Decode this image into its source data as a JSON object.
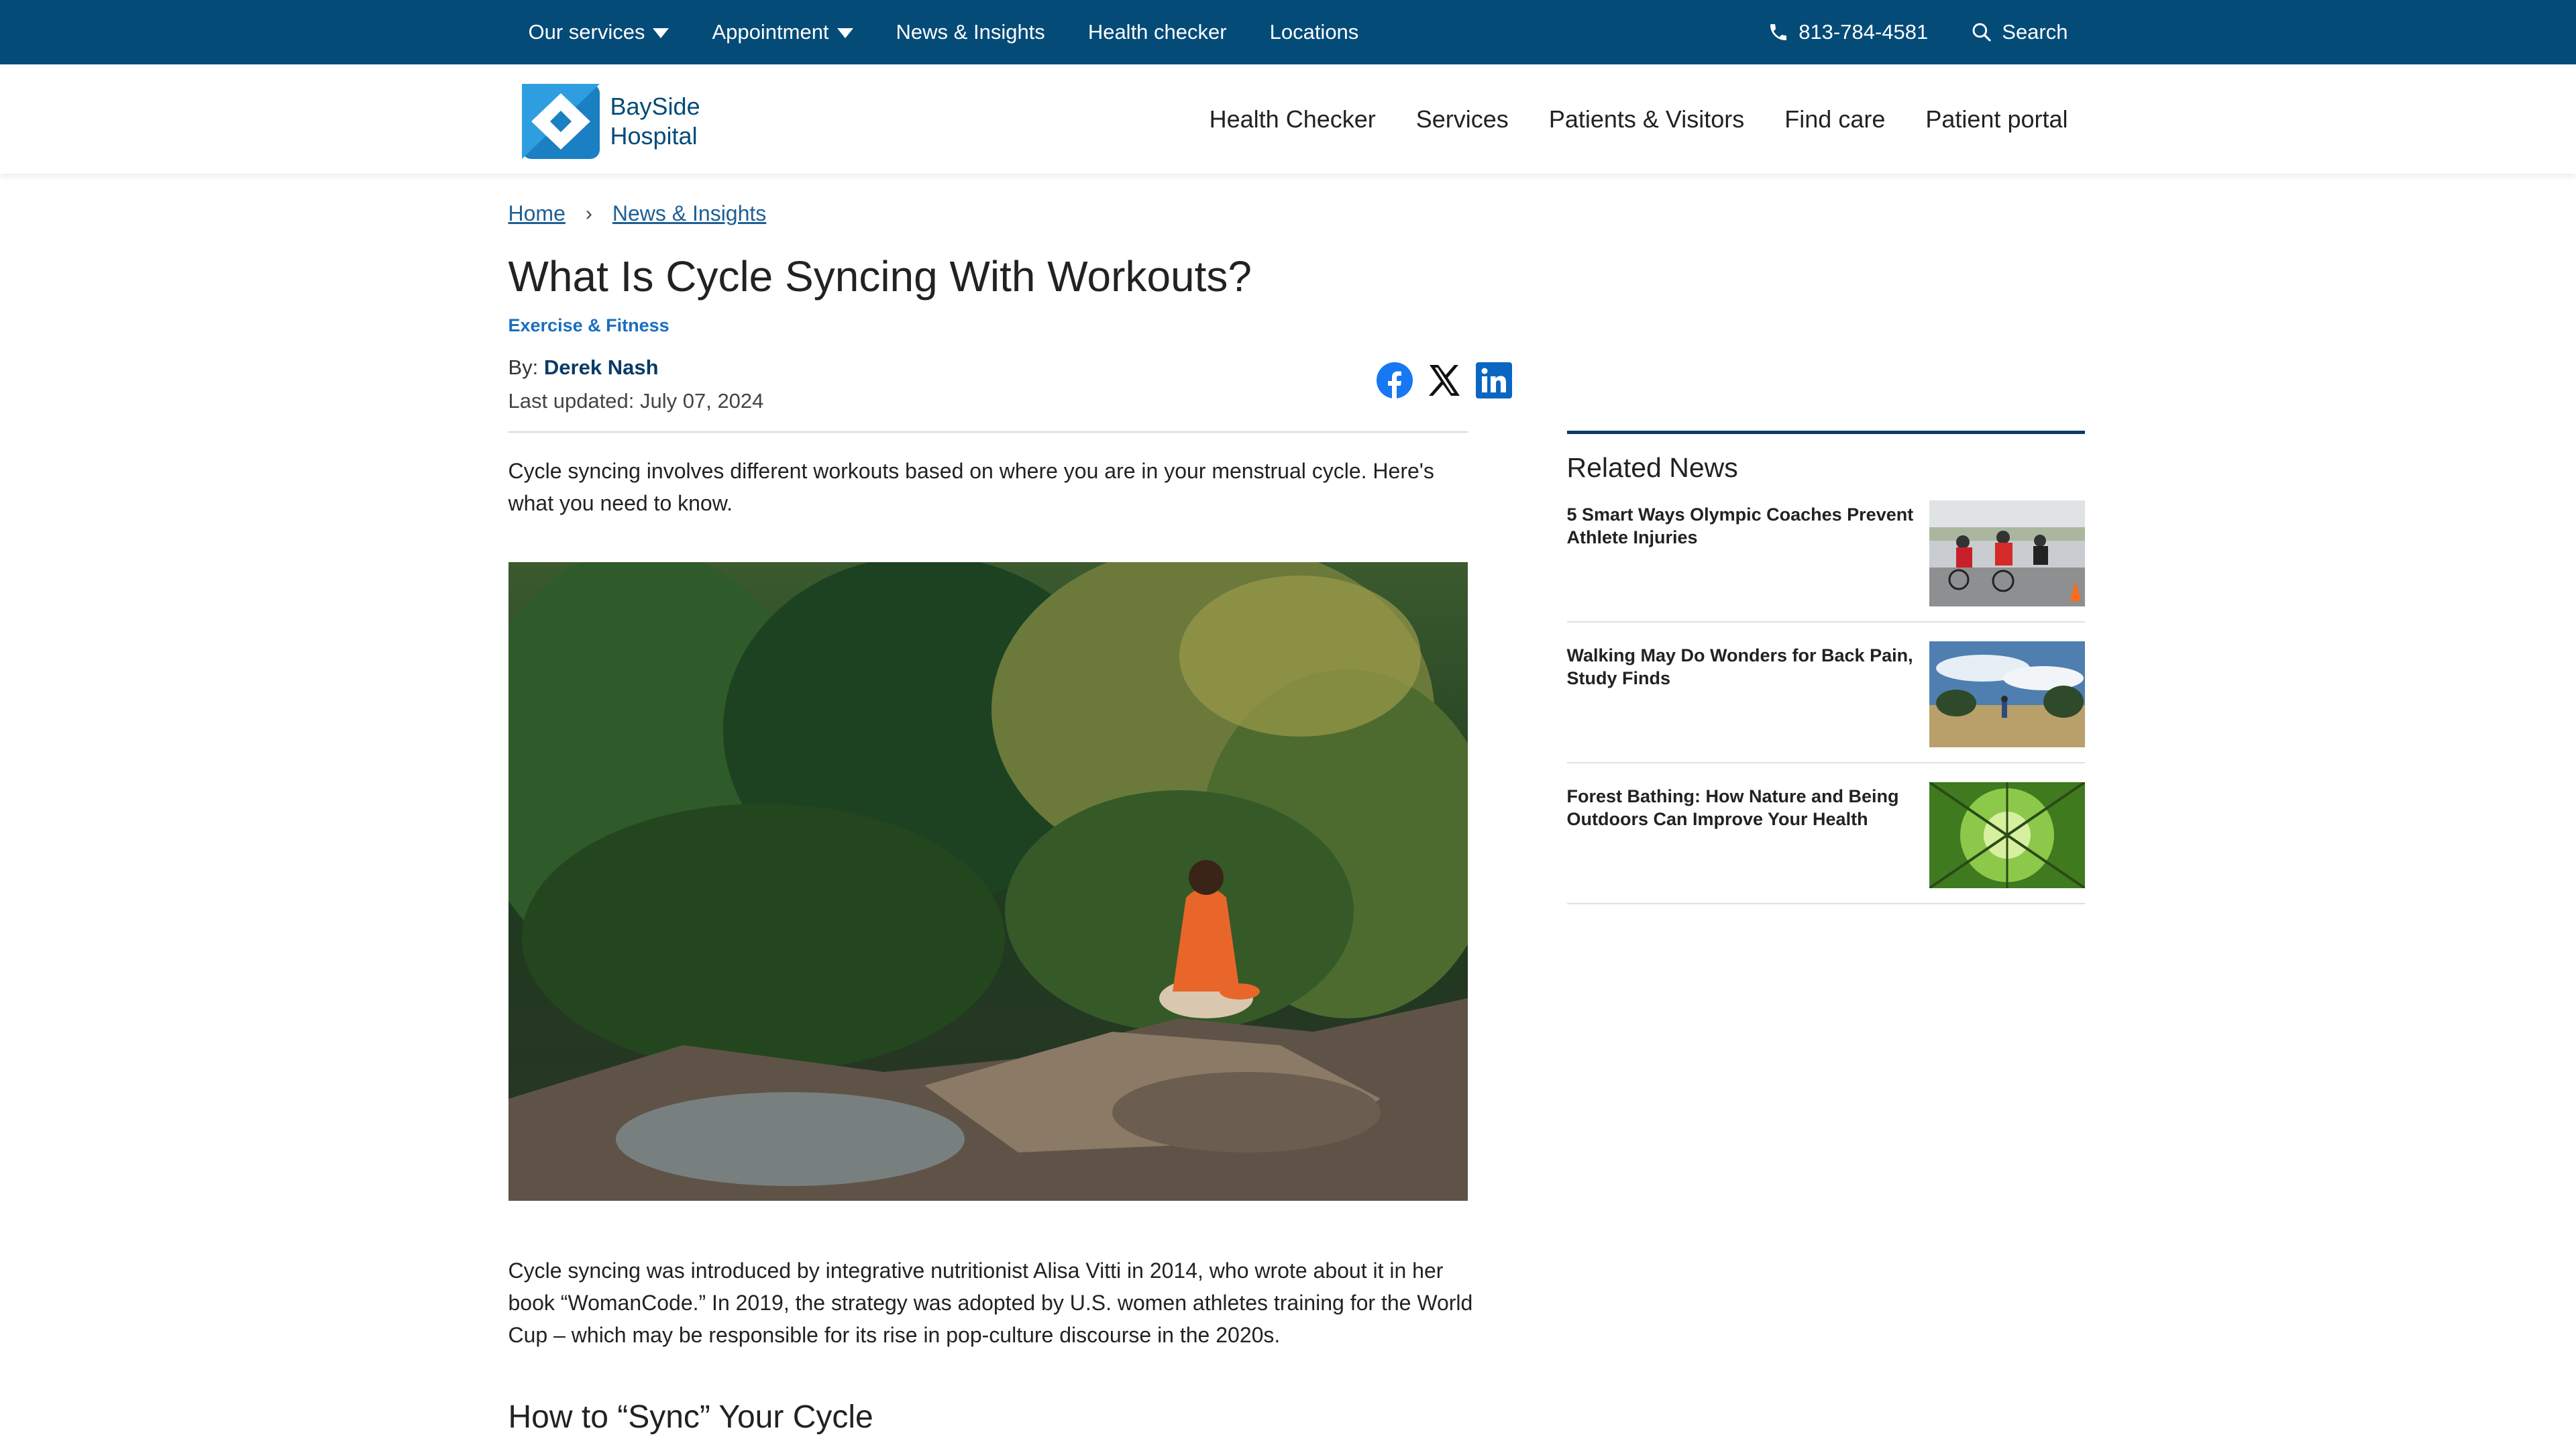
{
  "topbar": {
    "nav": [
      {
        "label": "Our services",
        "dropdown": true
      },
      {
        "label": "Appointment",
        "dropdown": true
      },
      {
        "label": "News & Insights",
        "dropdown": false
      },
      {
        "label": "Health checker",
        "dropdown": false
      },
      {
        "label": "Locations",
        "dropdown": false
      }
    ],
    "phone": "813-784-4581",
    "search_label": "Search"
  },
  "brand": {
    "name_line1": "BaySide",
    "name_line2": "Hospital"
  },
  "mainnav": [
    "Health Checker",
    "Services",
    "Patients & Visitors",
    "Find care",
    "Patient portal"
  ],
  "breadcrumb": {
    "home": "Home",
    "section": "News & Insights"
  },
  "article": {
    "title": "What Is Cycle Syncing With Workouts?",
    "category": "Exercise & Fitness",
    "by_label": "By:",
    "author": "Derek Nash",
    "updated": "Last updated: July 07, 2024",
    "intro": "Cycle syncing involves different workouts based on where you are in your menstrual cycle. Here's what you need to know.",
    "paragraph1": "Cycle syncing was introduced by integrative nutritionist Alisa Vitti in 2014, who wrote about it in her book “WomanCode.” In 2019, the strategy was adopted by U.S. women athletes training for the World Cup – which may be responsible for its rise in pop-culture discourse in the 2020s.",
    "heading2": "How to “Sync” Your Cycle"
  },
  "share_icons": [
    "facebook-icon",
    "x-icon",
    "linkedin-icon"
  ],
  "sidebar": {
    "title": "Related News",
    "items": [
      {
        "title": "5 Smart Ways Olympic Coaches Prevent Athlete Injuries"
      },
      {
        "title": "Walking May Do Wonders for Back Pain, Study Finds"
      },
      {
        "title": "Forest Bathing: How Nature and Being Outdoors Can Improve Your Health"
      }
    ]
  },
  "colors": {
    "brand_navy": "#044b78",
    "link_blue": "#1f5f94",
    "category_blue": "#1a6fbf",
    "accent_orange": "#e8662a"
  }
}
